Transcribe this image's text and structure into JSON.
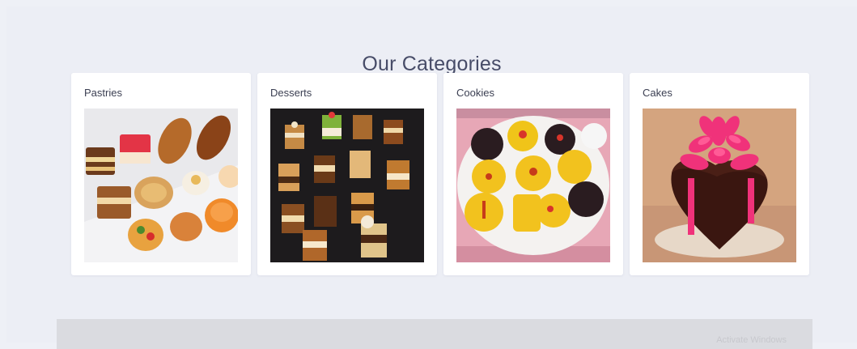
{
  "section": {
    "title": "Our Categories"
  },
  "categories": [
    {
      "label": "Pastries",
      "image": "pastries-photo"
    },
    {
      "label": "Desserts",
      "image": "desserts-photo"
    },
    {
      "label": "Cookies",
      "image": "cookies-photo"
    },
    {
      "label": "Cakes",
      "image": "cakes-photo"
    }
  ],
  "footer": {
    "watermark": "Activate Windows"
  },
  "colors": {
    "page_bg": "#eceef5",
    "card_bg": "#ffffff",
    "title": "#474c68",
    "label": "#3b3f52",
    "cake_ribbon": "#f0327a"
  }
}
